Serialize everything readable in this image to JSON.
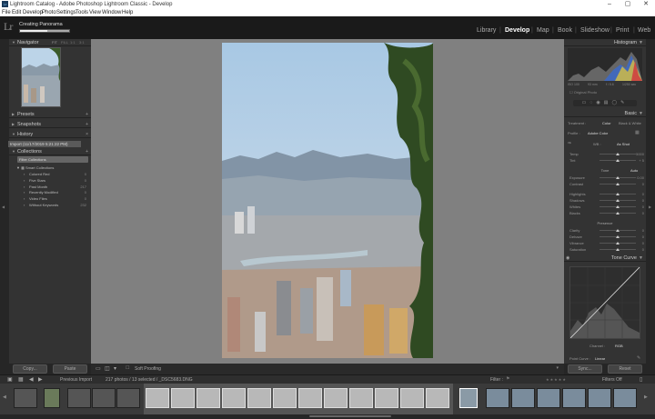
{
  "window": {
    "title": "Lightroom Catalog - Adobe Photoshop Lightroom Classic - Develop",
    "icon": "Lr"
  },
  "menu": [
    "File",
    "Edit",
    "Develop",
    "Photo",
    "Settings",
    "Tools",
    "View",
    "Window",
    "Help"
  ],
  "identity": {
    "logo": "Lr",
    "task": "Creating Panorama",
    "progress": 0.55
  },
  "modules": [
    "Library",
    "Develop",
    "Map",
    "Book",
    "Slideshow",
    "Print",
    "Web"
  ],
  "active_module": "Develop",
  "left": {
    "navigator": {
      "title": "Navigator",
      "zoom": [
        "FIT",
        "FILL",
        "1:1",
        "3:1"
      ]
    },
    "presets": "Presets",
    "snapshots": "Snapshots",
    "history": {
      "title": "History",
      "item": "Import (11/17/2019 5:21:22 PM)"
    },
    "collections": {
      "title": "Collections",
      "filter": "Filter Collections",
      "set": "Smart Collections",
      "items": [
        {
          "name": "Colored Red",
          "count": "0"
        },
        {
          "name": "Five Stars",
          "count": "0"
        },
        {
          "name": "Past Month",
          "count": "217"
        },
        {
          "name": "Recently Modified",
          "count": "0"
        },
        {
          "name": "Video Files",
          "count": "0"
        },
        {
          "name": "Without Keywords",
          "count": "232"
        }
      ]
    },
    "copy": "Copy...",
    "paste": "Paste"
  },
  "right": {
    "histogram": {
      "title": "Histogram",
      "iso": "ISO 100",
      "focal": "93 mm",
      "aperture": "f / 5.6",
      "shutter": "1/250 sec",
      "original": "Original Photo"
    },
    "basic": {
      "title": "Basic",
      "treatment": "Treatment :",
      "color": "Color",
      "bw": "Black & White",
      "profile_label": "Profile :",
      "profile": "Adobe Color",
      "wb_label": "WB :",
      "wb": "As Shot",
      "sliders1": [
        {
          "name": "Temp",
          "value": "5000"
        },
        {
          "name": "Tint",
          "value": "+ 5"
        }
      ],
      "tone": "Tone",
      "auto": "Auto",
      "sliders2": [
        {
          "name": "Exposure",
          "value": "0.00"
        },
        {
          "name": "Contrast",
          "value": "0"
        }
      ],
      "sliders3": [
        {
          "name": "Highlights",
          "value": "0"
        },
        {
          "name": "Shadows",
          "value": "0"
        },
        {
          "name": "Whites",
          "value": "0"
        },
        {
          "name": "Blacks",
          "value": "0"
        }
      ],
      "presence": "Presence",
      "sliders4": [
        {
          "name": "Clarity",
          "value": "0"
        },
        {
          "name": "Dehaze",
          "value": "0"
        },
        {
          "name": "Vibrance",
          "value": "0"
        },
        {
          "name": "Saturation",
          "value": "0"
        }
      ]
    },
    "tonecurve": {
      "title": "Tone Curve",
      "channel_label": "Channel :",
      "channel": "RGB",
      "point_curve_label": "Point Curve :",
      "point_curve": "Linear"
    },
    "sync": "Sync...",
    "reset": "Reset"
  },
  "toolbar": {
    "soft_proofing": "Soft Proofing"
  },
  "filmstrip": {
    "source": "Previous Import",
    "info": "217 photos / 13 selected / _DSC5683.DNG",
    "filter_label": "Filter :",
    "filters_off": "Filters Off"
  }
}
